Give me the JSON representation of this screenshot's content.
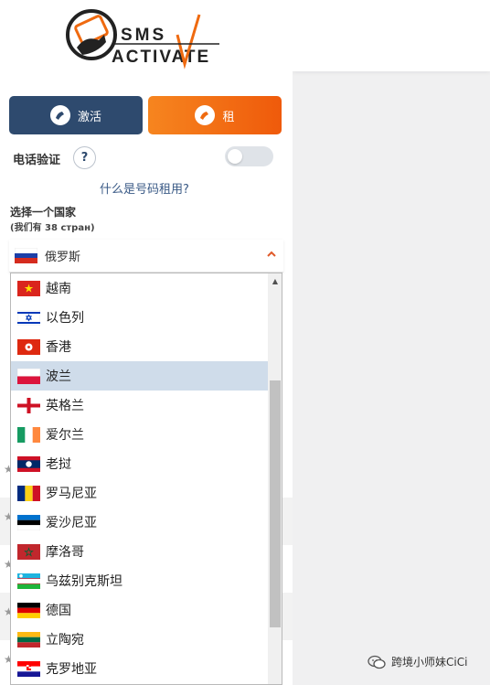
{
  "brand": {
    "logo_text_1": "SMS",
    "logo_text_2": "ACTIVATE"
  },
  "modes": {
    "activate_label": "激活",
    "rent_label": "租",
    "selected": "rent"
  },
  "phone_verify": {
    "label": "电话验证",
    "help": "?",
    "toggle_on": false
  },
  "rent_link": "什么是号码租用?",
  "country": {
    "title": "选择一个国家",
    "subtitle": "(我们有 38 стран)",
    "selected": "俄罗斯",
    "selected_flag": "russia-flag-icon"
  },
  "dropdown": {
    "highlighted": "波兰",
    "options": [
      {
        "name": "越南",
        "flag": "vietnam-flag-icon"
      },
      {
        "name": "以色列",
        "flag": "israel-flag-icon"
      },
      {
        "name": "香港",
        "flag": "hongkong-flag-icon"
      },
      {
        "name": "波兰",
        "flag": "poland-flag-icon"
      },
      {
        "name": "英格兰",
        "flag": "england-flag-icon"
      },
      {
        "name": "爱尔兰",
        "flag": "ireland-flag-icon"
      },
      {
        "name": "老挝",
        "flag": "laos-flag-icon"
      },
      {
        "name": "罗马尼亚",
        "flag": "romania-flag-icon"
      },
      {
        "name": "爱沙尼亚",
        "flag": "estonia-flag-icon"
      },
      {
        "name": "摩洛哥",
        "flag": "morocco-flag-icon"
      },
      {
        "name": "乌兹别克斯坦",
        "flag": "uzbekistan-flag-icon"
      },
      {
        "name": "德国",
        "flag": "germany-flag-icon"
      },
      {
        "name": "立陶宛",
        "flag": "lithuania-flag-icon"
      },
      {
        "name": "克罗地亚",
        "flag": "croatia-flag-icon"
      }
    ]
  },
  "watermark": {
    "text": "跨境小师妹CiCi"
  },
  "colors": {
    "activate": "#2e4a6e",
    "rent": "#f6851f",
    "link": "#3a5a86",
    "highlight": "#cfdcea"
  }
}
